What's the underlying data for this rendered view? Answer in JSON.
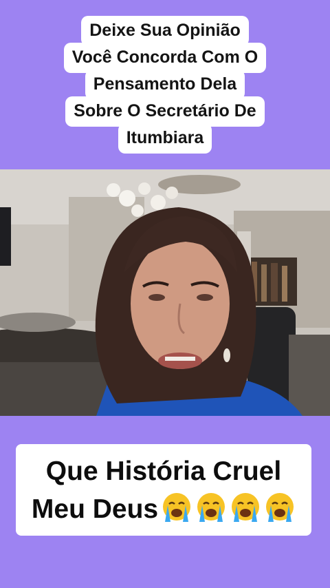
{
  "overlay_top": {
    "lines": [
      "Deixe Sua Opinião",
      "Você Concorda Com O",
      "Pensamento Dela",
      "Sobre O Secretário De",
      "Itumbiara"
    ]
  },
  "overlay_bottom": {
    "line1": "Que História Cruel",
    "line2": "Meu Deus",
    "emoji": [
      "loudly-crying-face-icon",
      "loudly-crying-face-icon",
      "loudly-crying-face-icon",
      "loudly-crying-face-icon"
    ]
  },
  "colors": {
    "background": "#9d83f2",
    "caption_bg": "#ffffff",
    "caption_text": "#141414",
    "emoji_face": "#f7c325",
    "emoji_tears": "#3aa8f0"
  }
}
